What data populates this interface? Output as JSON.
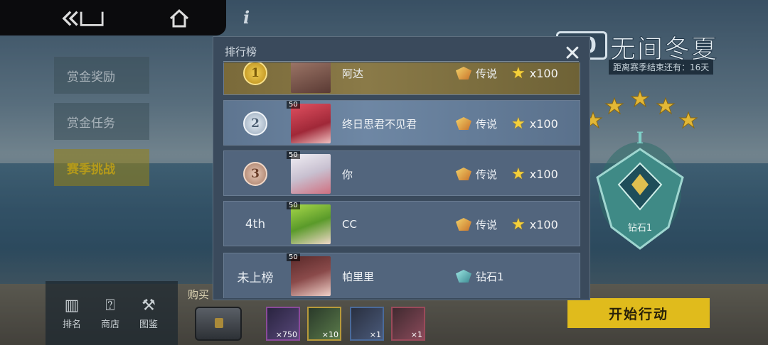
{
  "nav": {
    "back_icon": "back-icon",
    "home_icon": "home-icon",
    "info_icon": "i"
  },
  "sidebar": {
    "items": [
      {
        "label": "赏金奖励",
        "active": false
      },
      {
        "label": "赏金任务",
        "active": false
      },
      {
        "label": "赛季挑战",
        "active": true
      }
    ]
  },
  "bottom_nav": {
    "items": [
      {
        "label": "排名",
        "icon": "ranking-icon"
      },
      {
        "label": "商店",
        "icon": "shop-icon"
      },
      {
        "label": "图鉴",
        "icon": "collection-icon"
      }
    ]
  },
  "shop": {
    "buy_label": "购买",
    "loot": [
      "×750",
      "×10",
      "×1",
      "×1"
    ]
  },
  "season": {
    "logo": "20",
    "name": "无间冬夏",
    "time_left": "距离赛季结束还有：16天",
    "emblem_rank": "I",
    "emblem_label": "钻石1",
    "stars": 5,
    "start_button": "开始行动"
  },
  "leaderboard": {
    "title": "排行榜",
    "close_icon": "close-icon",
    "rows": [
      {
        "rank": "1",
        "medal": "m1",
        "level": "",
        "name": "阿达",
        "tier": "传说",
        "tier_kind": "legend",
        "reward": "x100",
        "style": "gold"
      },
      {
        "rank": "2",
        "medal": "m2",
        "level": "50",
        "name": "终日思君不见君",
        "tier": "传说",
        "tier_kind": "legend",
        "reward": "x100",
        "style": "silver"
      },
      {
        "rank": "3",
        "medal": "m3",
        "level": "50",
        "name": "你",
        "tier": "传说",
        "tier_kind": "legend",
        "reward": "x100",
        "style": "plain"
      },
      {
        "rank": "4th",
        "medal": "",
        "level": "50",
        "name": "CC",
        "tier": "传说",
        "tier_kind": "legend",
        "reward": "x100",
        "style": "plain"
      },
      {
        "rank": "未上榜",
        "medal": "",
        "level": "50",
        "name": "帕里里",
        "tier": "钻石1",
        "tier_kind": "diamond",
        "reward": "",
        "style": "plain"
      }
    ]
  },
  "colors": {
    "accent": "#e0bb1c",
    "panel": "#3a4a5c",
    "row": "#52657d"
  }
}
